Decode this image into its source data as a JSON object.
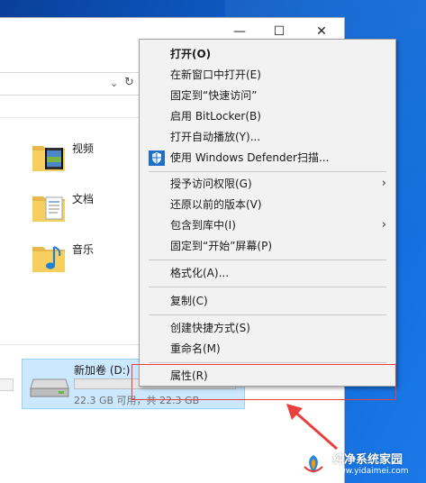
{
  "window": {
    "minimize_glyph": "—",
    "maximize_glyph": "☐",
    "close_glyph": "✕"
  },
  "folders": [
    {
      "name": "视频",
      "icon": "video-folder-icon"
    },
    {
      "name": "文档",
      "icon": "documents-folder-icon"
    },
    {
      "name": "音乐",
      "icon": "music-folder-icon"
    }
  ],
  "drive": {
    "name": "新加卷 (D:)",
    "free_text": "22.3 GB 可用，共 22.3 GB",
    "used_fraction": 0.0,
    "icon": "hard-drive-icon"
  },
  "context_menu": {
    "items": [
      {
        "label": "打开(O)",
        "bold": true
      },
      {
        "label": "在新窗口中打开(E)"
      },
      {
        "label": "固定到“快速访问”"
      },
      {
        "label": "启用 BitLocker(B)"
      },
      {
        "label": "打开自动播放(Y)..."
      },
      {
        "label": "使用 Windows Defender扫描...",
        "icon": "windows-defender-shield-icon"
      },
      {
        "label": "授予访问权限(G)",
        "submenu": true
      },
      {
        "label": "还原以前的版本(V)"
      },
      {
        "label": "包含到库中(I)",
        "submenu": true
      },
      {
        "label": "固定到“开始”屏幕(P)"
      },
      {
        "label": "格式化(A)..."
      },
      {
        "label": "复制(C)"
      },
      {
        "label": "创建快捷方式(S)"
      },
      {
        "label": "重命名(M)"
      },
      {
        "label": "属性(R)"
      }
    ],
    "submenu_arrow": "›"
  },
  "annotation": {
    "highlight_color": "#e8413d"
  },
  "watermark": {
    "title": "纯净系统家园",
    "url": "www.yidaimei.com"
  },
  "colors": {
    "desktop": "#0d63d0",
    "menu_bg": "#f2f2f2",
    "selection": "#cce8ff",
    "defender_blue": "#1f6fc8"
  }
}
